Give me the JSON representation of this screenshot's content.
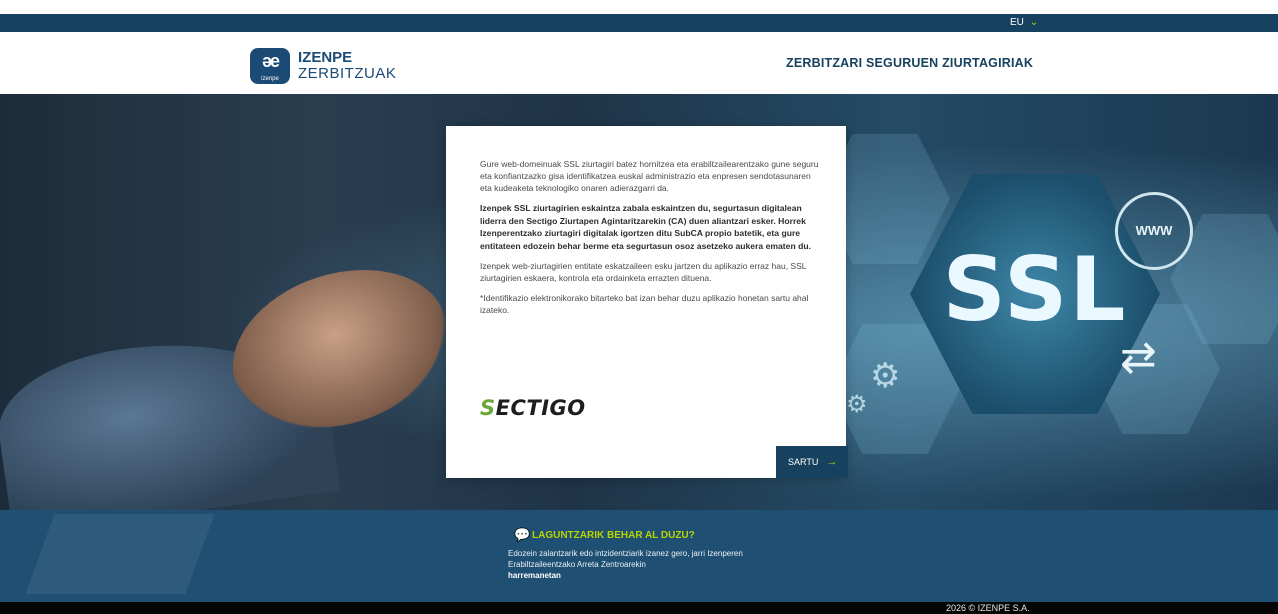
{
  "topbar": {
    "language": "EU",
    "language_icon": "chevron-down-icon"
  },
  "header": {
    "logo": {
      "mark": "əe",
      "small": "izenpe",
      "line1": "IZENPE",
      "line2": "ZERBITZUAK"
    },
    "title": "ZERBITZARI SEGURUEN ZIURTAGIRIAK"
  },
  "hero": {
    "ssl_label": "SSL",
    "www_label": "WWW"
  },
  "card": {
    "paragraph1": "Gure web-domeinuak SSL ziurtagiri batez hornitzea eta erabiltzailearentzako gune seguru eta konfiantzazko gisa identifikatzea euskal administrazio eta enpresen sendotasunaren eta kudeaketa teknologiko onaren adierazgarri da.",
    "paragraph2": "Izenpek SSL ziurtagirien eskaintza zabala eskaintzen du, segurtasun digitalean liderra den Sectigo Ziurtapen Agintaritzarekin (CA) duen aliantzari esker. Horrek Izenperentzako ziurtagiri digitalak igortzen ditu SubCA propio batetik, eta gure entitateen edozein behar berme eta segurtasun osoz asetzeko aukera ematen du.",
    "paragraph3": "Izenpek web-ziurtagirien entitate eskatzaileen esku jartzen du aplikazio erraz hau, SSL ziurtagirien eskaera, kontrola eta ordainketa errazten dituena.",
    "paragraph4": "*Identifikazio elektronikorako bitarteko bat izan behar duzu aplikazio honetan sartu ahal izateko.",
    "partner_logo_first": "S",
    "partner_logo_rest": "ECTIGO",
    "button": {
      "label": "SARTU",
      "icon": "arrow-right-icon"
    }
  },
  "help": {
    "icon": "chat-bubbles-icon",
    "title": "LAGUNTZARIK BEHAR AL DUZU?",
    "body": "Edozein zalantzarik edo intzidentziarik izanez gero, jarri Izenperen Erabiltzaileentzako Arreta Zentroarekin",
    "link": "harremanetan"
  },
  "footer": {
    "copyright": "2026 © IZENPE S.A."
  },
  "colors": {
    "navy": "#16415f",
    "accent": "#b8d400",
    "help_bg": "#1f4f73",
    "sectigo_green": "#6aa83b"
  }
}
